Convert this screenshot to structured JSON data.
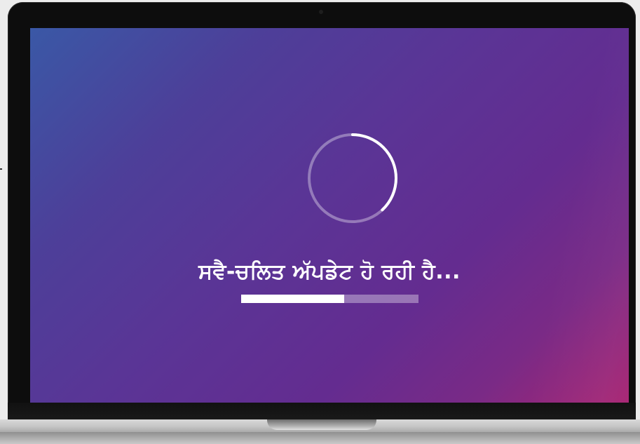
{
  "screen": {
    "status_text": "ਸਵੈ-ਚਲਿਤ ਅੱਪਡੇਟ ਹੋ ਰਹੀ ਹੈ...",
    "progress_fraction": 0.58,
    "spinner_arc_fraction": 0.38
  },
  "colors": {
    "gradient_start": "#3a58a6",
    "gradient_mid": "#5a3596",
    "gradient_end": "#a82573",
    "text": "#ffffff",
    "progress_track": "#a98fc4",
    "progress_fill": "#ffffff"
  },
  "icons": {
    "spinner": "loading-spinner-icon"
  }
}
